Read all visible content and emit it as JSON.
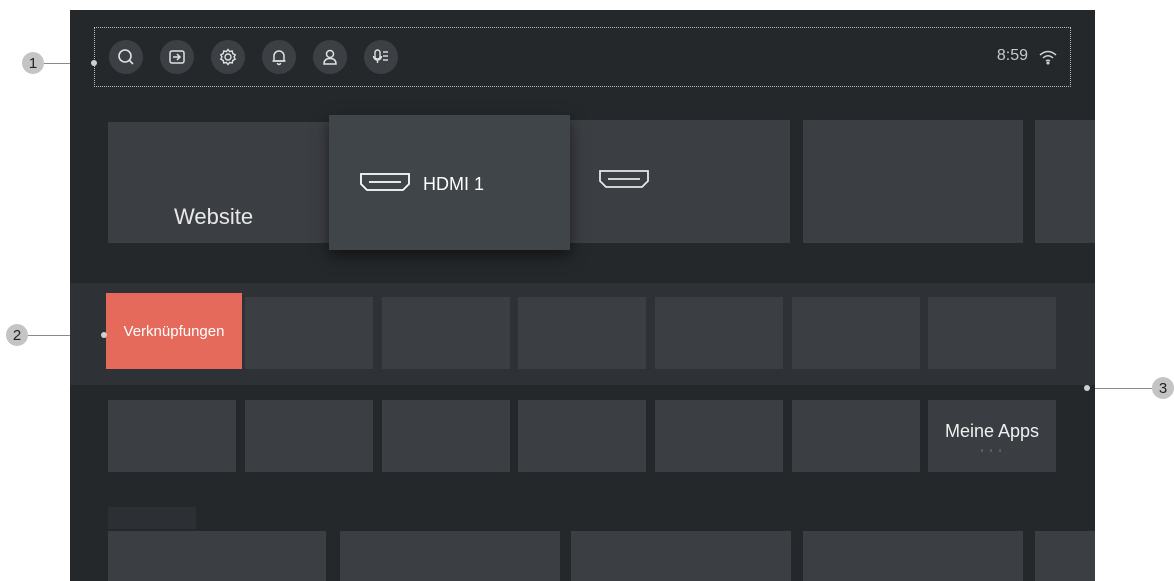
{
  "callouts": [
    "1",
    "2",
    "3"
  ],
  "topbar": {
    "icons": [
      "search-icon",
      "input-source-icon",
      "settings-icon",
      "notification-bell-icon",
      "profile-icon",
      "voice-assistant-icon"
    ],
    "clock": "8:59",
    "status_icon": "wifi-icon"
  },
  "row1": {
    "website_label": "Website",
    "hdmi1_label": "HDMI 1"
  },
  "shortcuts": {
    "focused_label": "Verknüpfungen"
  },
  "apps": {
    "my_apps_label": "Meine Apps",
    "my_apps_dots": "◦ ◦ ◦"
  },
  "colors": {
    "screen_bg": "#25282b",
    "tile": "#3b3f43",
    "accent": "#e56a5c"
  }
}
